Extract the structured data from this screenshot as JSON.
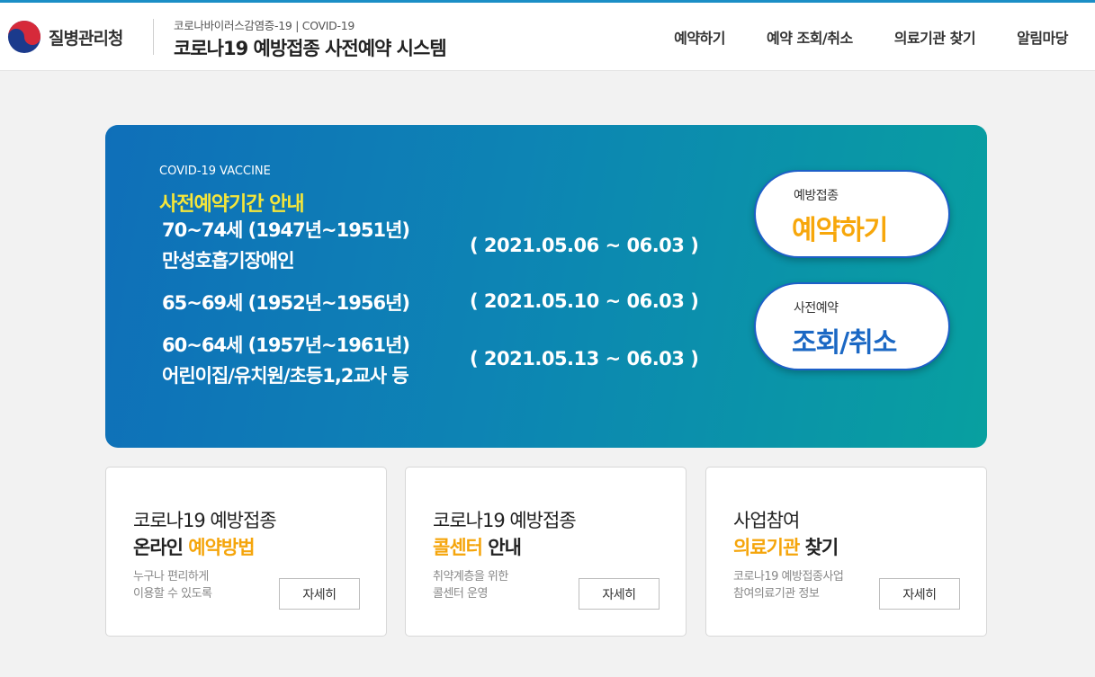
{
  "header": {
    "org_name": "질병관리청",
    "subtitle": "코로나바이러스감염증-19 | COVID-19",
    "title": "코로나19 예방접종 사전예약 시스템",
    "nav": [
      "예약하기",
      "예약 조회/취소",
      "의료기관 찾기",
      "알림마당"
    ]
  },
  "hero": {
    "eyebrow": "COVID-19 VACCINE",
    "heading": "사전예약기간 안내",
    "rows": [
      {
        "line1": "70~74세 (1947년~1951년)",
        "line2": "만성호흡기장애인",
        "period": "( 2021.05.06 ~ 06.03 )"
      },
      {
        "line1": "65~69세 (1952년~1956년)",
        "line2": "",
        "period": "( 2021.05.10 ~ 06.03 )"
      },
      {
        "line1": "60~64세 (1957년~1961년)",
        "line2": "어린이집/유치원/초등1,2교사 등",
        "period": "( 2021.05.13 ~ 06.03 )"
      }
    ],
    "cta_reserve": {
      "small": "예방접종",
      "big": "예약하기"
    },
    "cta_check": {
      "small": "사전예약",
      "big": "조회/취소"
    }
  },
  "cards": [
    {
      "line1": "코로나19 예방접종",
      "line2_plain": "온라인 ",
      "line2_highlight": "예약방법",
      "line2_suffix": "",
      "desc1": "누구나 편리하게",
      "desc2": "이용할 수 있도록",
      "button": "자세히"
    },
    {
      "line1": "코로나19 예방접종",
      "line2_plain": "",
      "line2_highlight": "콜센터",
      "line2_suffix": " 안내",
      "desc1": "취약계층을 위한",
      "desc2": "콜센터 운영",
      "button": "자세히"
    },
    {
      "line1": "사업참여",
      "line2_plain": "",
      "line2_highlight": "의료기관",
      "line2_suffix": " 찾기",
      "desc1": "코로나19 예방접종사업",
      "desc2": "참여의료기관 정보",
      "button": "자세히"
    }
  ],
  "colors": {
    "accent_yellow": "#f5a50b",
    "brand_blue": "#1b68c4",
    "hero_gradient_start": "#0f6fb9",
    "hero_gradient_end": "#08a0a0"
  }
}
